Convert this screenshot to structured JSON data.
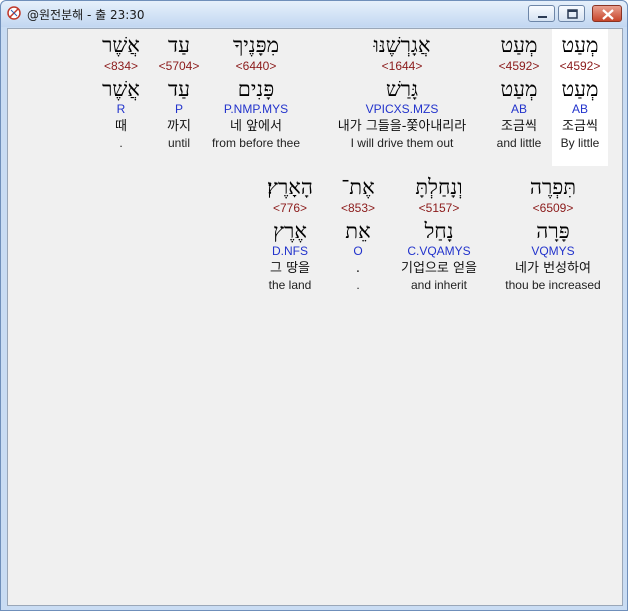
{
  "window": {
    "title": "@원전분해 - 출 23:30",
    "buttons": {
      "minimize": "minimize-icon",
      "maximize": "maximize-icon",
      "close": "close-icon"
    }
  },
  "line1": [
    {
      "heb": "מְעַט",
      "strong": "<4592>",
      "lemma": "מְעַט",
      "morph": "AB",
      "kor": "조금씩",
      "eng": "By little",
      "highlight": true
    },
    {
      "heb": "מְעַט",
      "strong": "<4592>",
      "lemma": "מְעַט",
      "morph": "AB",
      "kor": "조금씩",
      "eng": "and little"
    },
    {
      "heb": "אֲגָרְשֶׁנּוּ",
      "strong": "<1644>",
      "lemma": "גָּרַשׁ",
      "morph": "VPICXS.MZS",
      "kor": "내가 그들을-쫓아내리라",
      "eng": "I will drive them out"
    },
    {
      "heb": "מִפָּנֶיךָ",
      "strong": "<6440>",
      "lemma": "פָּנִים",
      "morph": "P.NMP.MYS",
      "kor": "네 앞에서",
      "eng": "from before thee"
    },
    {
      "heb": "עַד",
      "strong": "<5704>",
      "lemma": "עַד",
      "morph": "P",
      "kor": "까지",
      "eng": "until"
    },
    {
      "heb": "אֲשֶׁר",
      "strong": "<834>",
      "lemma": "אֲשֶׁר",
      "morph": "R",
      "kor": "때",
      "eng": "."
    }
  ],
  "line2": [
    {
      "heb": "תִּפְרֶה",
      "strong": "<6509>",
      "lemma": "פָּרָה",
      "morph": "VQMYS",
      "kor": "네가 번성하여",
      "eng": "thou be increased"
    },
    {
      "heb": "וְנָחַלְתָּ",
      "strong": "<5157>",
      "lemma": "נָחַל",
      "morph": "C.VQAMYS",
      "kor": "기업으로 얻을",
      "eng": "and inherit"
    },
    {
      "heb": "אֶת־",
      "strong": "<853>",
      "lemma": "אֵת",
      "morph": "O",
      "kor": ".",
      "eng": "."
    },
    {
      "heb": "הָאָרֶץ׃",
      "strong": "<776>",
      "lemma": "אֶרֶץ",
      "morph": "D.NFS",
      "kor": "그 땅을",
      "eng": "the land"
    }
  ]
}
